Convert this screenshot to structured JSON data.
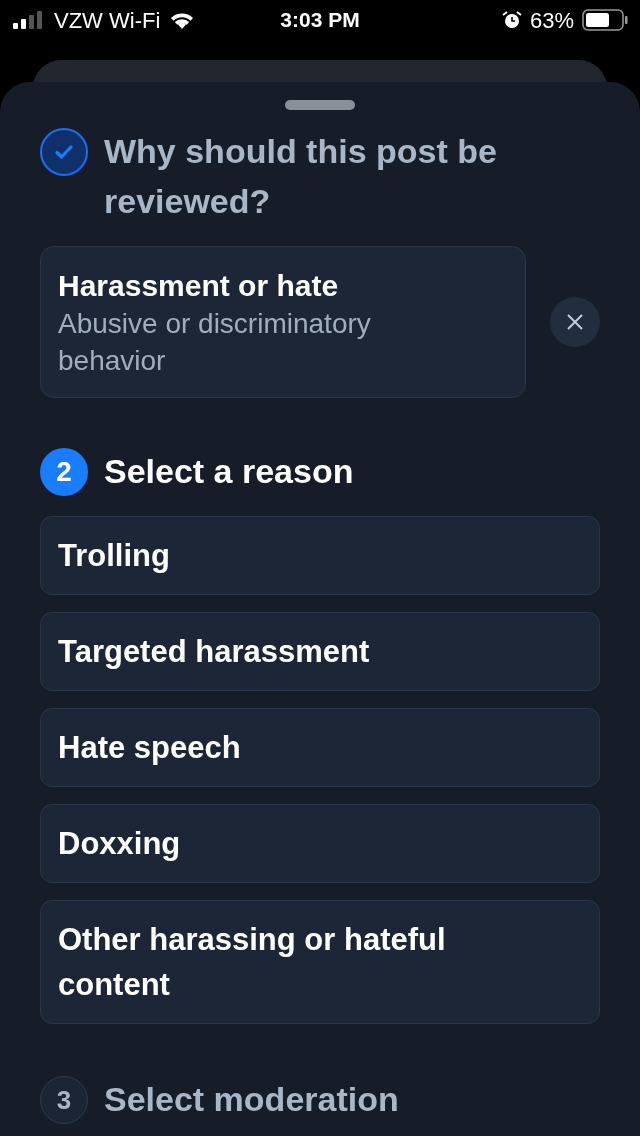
{
  "status_bar": {
    "carrier": "VZW Wi-Fi",
    "time": "3:03 PM",
    "battery": "63%"
  },
  "steps": [
    {
      "kind": "done",
      "title": "Why should this post be reviewed?",
      "selection": {
        "title": "Harassment or hate",
        "subtitle": "Abusive or discriminatory behavior"
      }
    },
    {
      "marker": "2",
      "kind": "active",
      "title": "Select a reason",
      "options": [
        "Trolling",
        "Targeted harassment",
        "Hate speech",
        "Doxxing",
        "Other harassing or hateful content"
      ]
    },
    {
      "marker": "3",
      "kind": "pending",
      "title": "Select moderation"
    }
  ]
}
